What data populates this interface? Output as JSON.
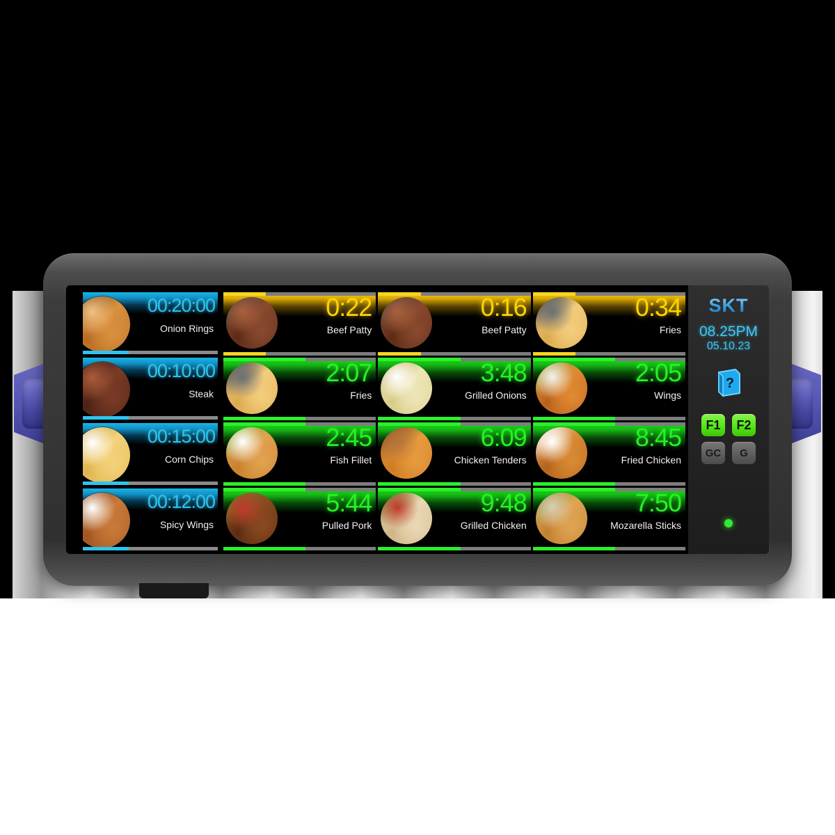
{
  "device": {
    "label": "kitchen-timer-display"
  },
  "sidebar": {
    "logo": "SKT",
    "time": "08.25PM",
    "date": "05.10.23",
    "help_icon": "help-book-icon",
    "buttons": [
      {
        "label": "F1",
        "style": "green"
      },
      {
        "label": "F2",
        "style": "green"
      },
      {
        "label": "GC",
        "style": "gray"
      },
      {
        "label": "G",
        "style": "gray"
      }
    ],
    "status_led": "power-led-green"
  },
  "colors": {
    "cyan": "#2ec4f0",
    "green": "#25f225",
    "yellow": "#ffd400",
    "led_green": "#35e835",
    "logo_blue": "#3aa7e8"
  },
  "left_column": [
    {
      "time": "00:20:00",
      "name": "Onion Rings",
      "progress": 34,
      "image": "onion-rings-photo"
    },
    {
      "time": "00:10:00",
      "name": "Steak",
      "progress": 34,
      "image": "steak-photo"
    },
    {
      "time": "00:15:00",
      "name": "Corn Chips",
      "progress": 34,
      "image": "corn-chips-photo"
    },
    {
      "time": "00:12:00",
      "name": "Spicy Wings",
      "progress": 34,
      "image": "spicy-wings-photo"
    }
  ],
  "grid": [
    {
      "time": "0:22",
      "name": "Beef Patty",
      "state": "urgent",
      "progress": 28,
      "image": "beef-patty-photo"
    },
    {
      "time": "0:16",
      "name": "Beef Patty",
      "state": "urgent",
      "progress": 28,
      "image": "beef-patty-photo"
    },
    {
      "time": "0:34",
      "name": "Fries",
      "state": "urgent",
      "progress": 28,
      "image": "fries-photo"
    },
    {
      "time": "2:07",
      "name": "Fries",
      "state": "ok",
      "progress": 54,
      "image": "fries-photo"
    },
    {
      "time": "3:48",
      "name": "Grilled Onions",
      "state": "ok",
      "progress": 54,
      "image": "grilled-onions-photo"
    },
    {
      "time": "2:05",
      "name": "Wings",
      "state": "ok",
      "progress": 54,
      "image": "wings-photo"
    },
    {
      "time": "2:45",
      "name": "Fish Fillet",
      "state": "ok",
      "progress": 54,
      "image": "fish-fillet-photo"
    },
    {
      "time": "6:09",
      "name": "Chicken Tenders",
      "state": "ok",
      "progress": 54,
      "image": "chicken-tenders-photo"
    },
    {
      "time": "8:45",
      "name": "Fried Chicken",
      "state": "ok",
      "progress": 54,
      "image": "fried-chicken-photo"
    },
    {
      "time": "5:44",
      "name": "Pulled Pork",
      "state": "ok",
      "progress": 54,
      "image": "pulled-pork-photo"
    },
    {
      "time": "9:48",
      "name": "Grilled Chicken",
      "state": "ok",
      "progress": 54,
      "image": "grilled-chicken-photo"
    },
    {
      "time": "7:50",
      "name": "Mozarella Sticks",
      "state": "ok",
      "progress": 54,
      "image": "mozarella-sticks-photo"
    }
  ]
}
